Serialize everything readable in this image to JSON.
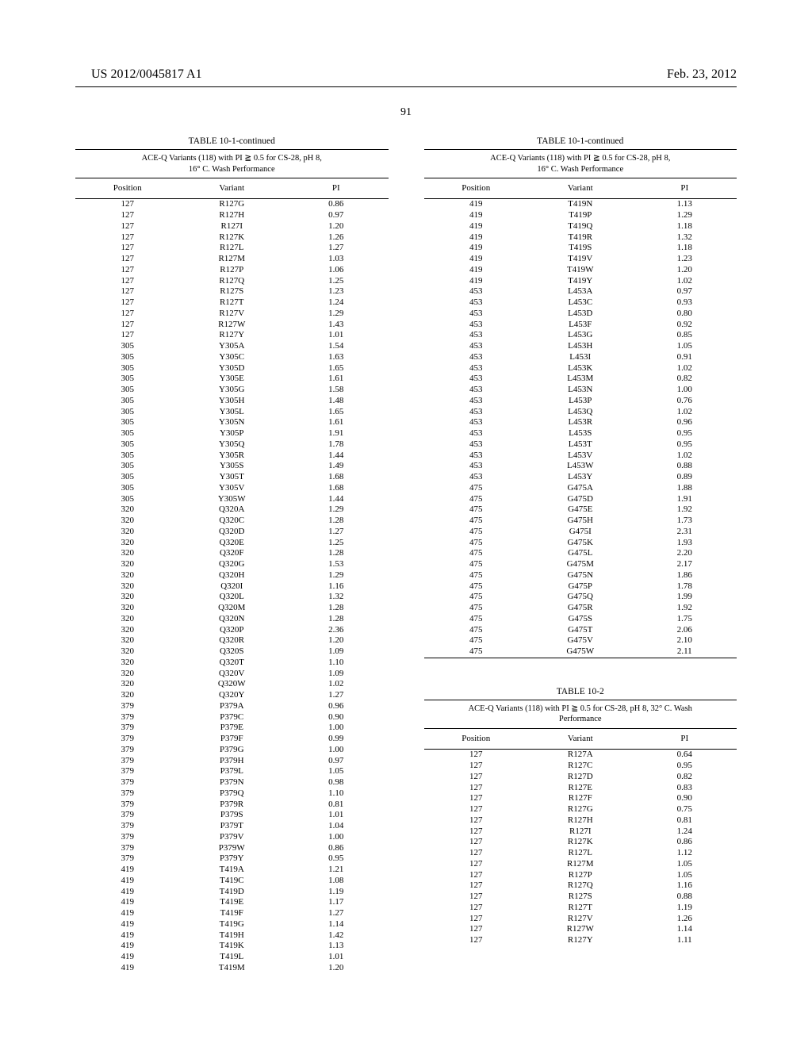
{
  "header": {
    "left": "US 2012/0045817 A1",
    "right": "Feb. 23, 2012"
  },
  "page_number": "91",
  "table_101_title": "TABLE 10-1-continued",
  "table_101_caption1": "ACE-Q Variants (118) with PI ≧ 0.5 for CS-28, pH 8,",
  "table_101_caption2": "16° C. Wash Performance",
  "table_101_headers": [
    "Position",
    "Variant",
    "PI"
  ],
  "table_101_left": [
    [
      "127",
      "R127G",
      "0.86"
    ],
    [
      "127",
      "R127H",
      "0.97"
    ],
    [
      "127",
      "R127I",
      "1.20"
    ],
    [
      "127",
      "R127K",
      "1.26"
    ],
    [
      "127",
      "R127L",
      "1.27"
    ],
    [
      "127",
      "R127M",
      "1.03"
    ],
    [
      "127",
      "R127P",
      "1.06"
    ],
    [
      "127",
      "R127Q",
      "1.25"
    ],
    [
      "127",
      "R127S",
      "1.23"
    ],
    [
      "127",
      "R127T",
      "1.24"
    ],
    [
      "127",
      "R127V",
      "1.29"
    ],
    [
      "127",
      "R127W",
      "1.43"
    ],
    [
      "127",
      "R127Y",
      "1.01"
    ],
    [
      "305",
      "Y305A",
      "1.54"
    ],
    [
      "305",
      "Y305C",
      "1.63"
    ],
    [
      "305",
      "Y305D",
      "1.65"
    ],
    [
      "305",
      "Y305E",
      "1.61"
    ],
    [
      "305",
      "Y305G",
      "1.58"
    ],
    [
      "305",
      "Y305H",
      "1.48"
    ],
    [
      "305",
      "Y305L",
      "1.65"
    ],
    [
      "305",
      "Y305N",
      "1.61"
    ],
    [
      "305",
      "Y305P",
      "1.91"
    ],
    [
      "305",
      "Y305Q",
      "1.78"
    ],
    [
      "305",
      "Y305R",
      "1.44"
    ],
    [
      "305",
      "Y305S",
      "1.49"
    ],
    [
      "305",
      "Y305T",
      "1.68"
    ],
    [
      "305",
      "Y305V",
      "1.68"
    ],
    [
      "305",
      "Y305W",
      "1.44"
    ],
    [
      "320",
      "Q320A",
      "1.29"
    ],
    [
      "320",
      "Q320C",
      "1.28"
    ],
    [
      "320",
      "Q320D",
      "1.27"
    ],
    [
      "320",
      "Q320E",
      "1.25"
    ],
    [
      "320",
      "Q320F",
      "1.28"
    ],
    [
      "320",
      "Q320G",
      "1.53"
    ],
    [
      "320",
      "Q320H",
      "1.29"
    ],
    [
      "320",
      "Q320I",
      "1.16"
    ],
    [
      "320",
      "Q320L",
      "1.32"
    ],
    [
      "320",
      "Q320M",
      "1.28"
    ],
    [
      "320",
      "Q320N",
      "1.28"
    ],
    [
      "320",
      "Q320P",
      "2.36"
    ],
    [
      "320",
      "Q320R",
      "1.20"
    ],
    [
      "320",
      "Q320S",
      "1.09"
    ],
    [
      "320",
      "Q320T",
      "1.10"
    ],
    [
      "320",
      "Q320V",
      "1.09"
    ],
    [
      "320",
      "Q320W",
      "1.02"
    ],
    [
      "320",
      "Q320Y",
      "1.27"
    ],
    [
      "379",
      "P379A",
      "0.96"
    ],
    [
      "379",
      "P379C",
      "0.90"
    ],
    [
      "379",
      "P379E",
      "1.00"
    ],
    [
      "379",
      "P379F",
      "0.99"
    ],
    [
      "379",
      "P379G",
      "1.00"
    ],
    [
      "379",
      "P379H",
      "0.97"
    ],
    [
      "379",
      "P379L",
      "1.05"
    ],
    [
      "379",
      "P379N",
      "0.98"
    ],
    [
      "379",
      "P379Q",
      "1.10"
    ],
    [
      "379",
      "P379R",
      "0.81"
    ],
    [
      "379",
      "P379S",
      "1.01"
    ],
    [
      "379",
      "P379T",
      "1.04"
    ],
    [
      "379",
      "P379V",
      "1.00"
    ],
    [
      "379",
      "P379W",
      "0.86"
    ],
    [
      "379",
      "P379Y",
      "0.95"
    ],
    [
      "419",
      "T419A",
      "1.21"
    ],
    [
      "419",
      "T419C",
      "1.08"
    ],
    [
      "419",
      "T419D",
      "1.19"
    ],
    [
      "419",
      "T419E",
      "1.17"
    ],
    [
      "419",
      "T419F",
      "1.27"
    ],
    [
      "419",
      "T419G",
      "1.14"
    ],
    [
      "419",
      "T419H",
      "1.42"
    ],
    [
      "419",
      "T419K",
      "1.13"
    ],
    [
      "419",
      "T419L",
      "1.01"
    ],
    [
      "419",
      "T419M",
      "1.20"
    ]
  ],
  "table_101_right": [
    [
      "419",
      "T419N",
      "1.13"
    ],
    [
      "419",
      "T419P",
      "1.29"
    ],
    [
      "419",
      "T419Q",
      "1.18"
    ],
    [
      "419",
      "T419R",
      "1.32"
    ],
    [
      "419",
      "T419S",
      "1.18"
    ],
    [
      "419",
      "T419V",
      "1.23"
    ],
    [
      "419",
      "T419W",
      "1.20"
    ],
    [
      "419",
      "T419Y",
      "1.02"
    ],
    [
      "453",
      "L453A",
      "0.97"
    ],
    [
      "453",
      "L453C",
      "0.93"
    ],
    [
      "453",
      "L453D",
      "0.80"
    ],
    [
      "453",
      "L453F",
      "0.92"
    ],
    [
      "453",
      "L453G",
      "0.85"
    ],
    [
      "453",
      "L453H",
      "1.05"
    ],
    [
      "453",
      "L453I",
      "0.91"
    ],
    [
      "453",
      "L453K",
      "1.02"
    ],
    [
      "453",
      "L453M",
      "0.82"
    ],
    [
      "453",
      "L453N",
      "1.00"
    ],
    [
      "453",
      "L453P",
      "0.76"
    ],
    [
      "453",
      "L453Q",
      "1.02"
    ],
    [
      "453",
      "L453R",
      "0.96"
    ],
    [
      "453",
      "L453S",
      "0.95"
    ],
    [
      "453",
      "L453T",
      "0.95"
    ],
    [
      "453",
      "L453V",
      "1.02"
    ],
    [
      "453",
      "L453W",
      "0.88"
    ],
    [
      "453",
      "L453Y",
      "0.89"
    ],
    [
      "475",
      "G475A",
      "1.88"
    ],
    [
      "475",
      "G475D",
      "1.91"
    ],
    [
      "475",
      "G475E",
      "1.92"
    ],
    [
      "475",
      "G475H",
      "1.73"
    ],
    [
      "475",
      "G475I",
      "2.31"
    ],
    [
      "475",
      "G475K",
      "1.93"
    ],
    [
      "475",
      "G475L",
      "2.20"
    ],
    [
      "475",
      "G475M",
      "2.17"
    ],
    [
      "475",
      "G475N",
      "1.86"
    ],
    [
      "475",
      "G475P",
      "1.78"
    ],
    [
      "475",
      "G475Q",
      "1.99"
    ],
    [
      "475",
      "G475R",
      "1.92"
    ],
    [
      "475",
      "G475S",
      "1.75"
    ],
    [
      "475",
      "G475T",
      "2.06"
    ],
    [
      "475",
      "G475V",
      "2.10"
    ],
    [
      "475",
      "G475W",
      "2.11"
    ]
  ],
  "table_102_title": "TABLE 10-2",
  "table_102_caption1": "ACE-Q Variants (118) with PI ≧ 0.5 for CS-28, pH 8, 32° C. Wash",
  "table_102_caption2": "Performance",
  "table_102_headers": [
    "Position",
    "Variant",
    "PI"
  ],
  "table_102_rows": [
    [
      "127",
      "R127A",
      "0.64"
    ],
    [
      "127",
      "R127C",
      "0.95"
    ],
    [
      "127",
      "R127D",
      "0.82"
    ],
    [
      "127",
      "R127E",
      "0.83"
    ],
    [
      "127",
      "R127F",
      "0.90"
    ],
    [
      "127",
      "R127G",
      "0.75"
    ],
    [
      "127",
      "R127H",
      "0.81"
    ],
    [
      "127",
      "R127I",
      "1.24"
    ],
    [
      "127",
      "R127K",
      "0.86"
    ],
    [
      "127",
      "R127L",
      "1.12"
    ],
    [
      "127",
      "R127M",
      "1.05"
    ],
    [
      "127",
      "R127P",
      "1.05"
    ],
    [
      "127",
      "R127Q",
      "1.16"
    ],
    [
      "127",
      "R127S",
      "0.88"
    ],
    [
      "127",
      "R127T",
      "1.19"
    ],
    [
      "127",
      "R127V",
      "1.26"
    ],
    [
      "127",
      "R127W",
      "1.14"
    ],
    [
      "127",
      "R127Y",
      "1.11"
    ]
  ]
}
